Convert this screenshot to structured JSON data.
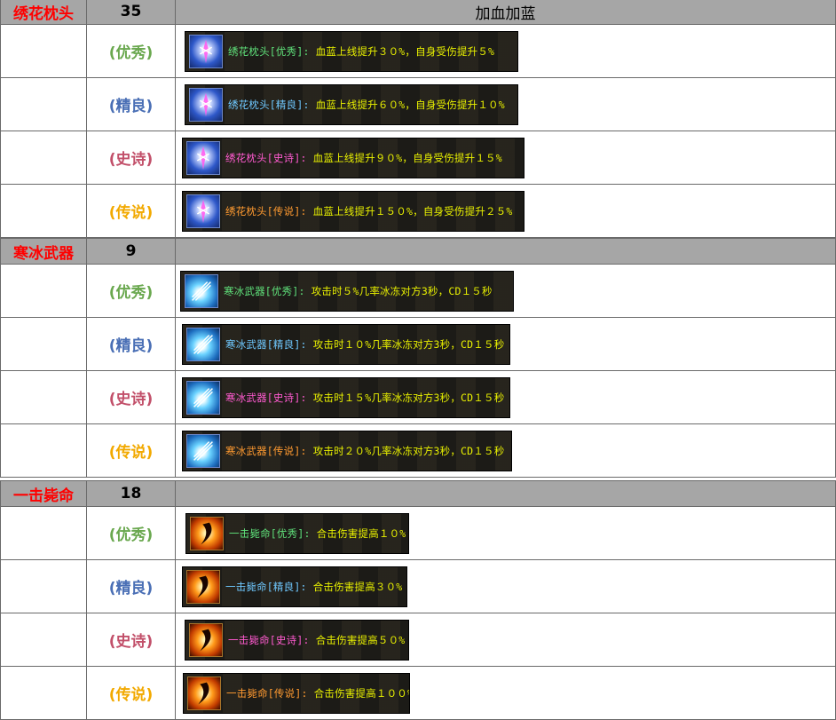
{
  "colors": {
    "tier_excellent": "#6aa84f",
    "tier_fine": "#4a6fb5",
    "tier_epic": "#c2506a",
    "tier_legend": "#f2a900",
    "header_bg": "#a6a6a6",
    "category_name": "#ff0000"
  },
  "groups": [
    {
      "name": "绣花枕头",
      "count": "35",
      "effect": "加血加蓝",
      "icon": "pillow-icon",
      "tiers": [
        {
          "tier": "(优秀)",
          "label": "绣花枕头[优秀]:",
          "desc": "血蓝上线提升３０%，自身受伤提升５%"
        },
        {
          "tier": "(精良)",
          "label": "绣花枕头[精良]:",
          "desc": "血蓝上线提升６０%，自身受伤提升１０%"
        },
        {
          "tier": "(史诗)",
          "label": "绣花枕头[史诗]:",
          "desc": "血蓝上线提升９０%，自身受伤提升１５%"
        },
        {
          "tier": "(传说)",
          "label": "绣花枕头[传说]:",
          "desc": "血蓝上线提升１５０%，自身受伤提升２５%"
        }
      ]
    },
    {
      "name": "寒冰武器",
      "count": "9",
      "effect": "",
      "icon": "ice-icon",
      "tiers": [
        {
          "tier": "(优秀)",
          "label": "寒冰武器[优秀]:",
          "desc": "攻击时５%几率冰冻对方3秒，CD１５秒"
        },
        {
          "tier": "(精良)",
          "label": "寒冰武器[精良]:",
          "desc": "攻击时１０%几率冰冻对方3秒，CD１５秒"
        },
        {
          "tier": "(史诗)",
          "label": "寒冰武器[史诗]:",
          "desc": "攻击时１５%几率冰冻对方3秒，CD１５秒"
        },
        {
          "tier": "(传说)",
          "label": "寒冰武器[传说]:",
          "desc": "攻击时２０%几率冰冻对方3秒，CD１５秒"
        }
      ]
    },
    {
      "name": "一击毙命",
      "count": "18",
      "effect": "",
      "icon": "slash-icon",
      "tiers": [
        {
          "tier": "(优秀)",
          "label": "一击毙命[优秀]:",
          "desc": "合击伤害提高１０%"
        },
        {
          "tier": "(精良)",
          "label": "一击毙命[精良]:",
          "desc": "合击伤害提高３０%"
        },
        {
          "tier": "(史诗)",
          "label": "一击毙命[史诗]:",
          "desc": "合击伤害提高５０%"
        },
        {
          "tier": "(传说)",
          "label": "一击毙命[传说]:",
          "desc": "合击伤害提高１００%"
        }
      ]
    }
  ]
}
